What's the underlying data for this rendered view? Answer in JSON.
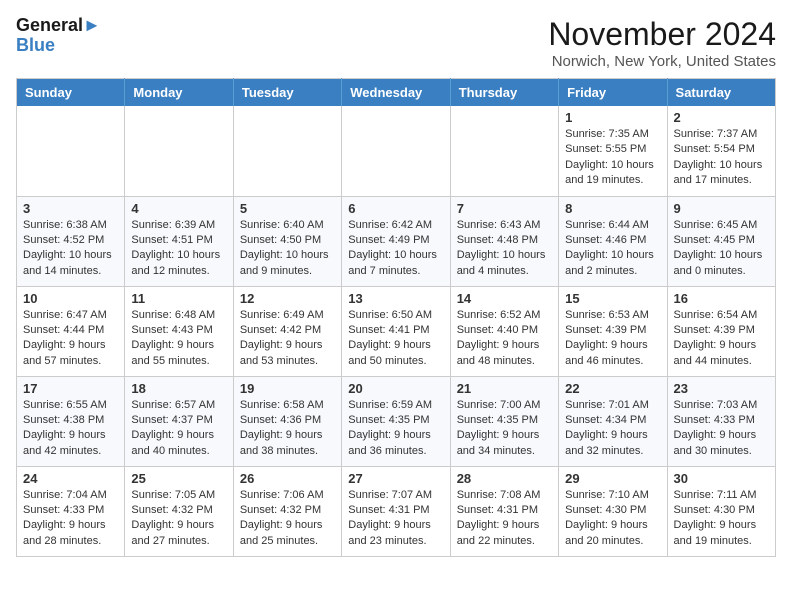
{
  "header": {
    "logo_line1": "General",
    "logo_line2": "Blue",
    "month_title": "November 2024",
    "location": "Norwich, New York, United States"
  },
  "weekdays": [
    "Sunday",
    "Monday",
    "Tuesday",
    "Wednesday",
    "Thursday",
    "Friday",
    "Saturday"
  ],
  "weeks": [
    [
      {
        "day": "",
        "text": ""
      },
      {
        "day": "",
        "text": ""
      },
      {
        "day": "",
        "text": ""
      },
      {
        "day": "",
        "text": ""
      },
      {
        "day": "",
        "text": ""
      },
      {
        "day": "1",
        "text": "Sunrise: 7:35 AM\nSunset: 5:55 PM\nDaylight: 10 hours and 19 minutes."
      },
      {
        "day": "2",
        "text": "Sunrise: 7:37 AM\nSunset: 5:54 PM\nDaylight: 10 hours and 17 minutes."
      }
    ],
    [
      {
        "day": "3",
        "text": "Sunrise: 6:38 AM\nSunset: 4:52 PM\nDaylight: 10 hours and 14 minutes."
      },
      {
        "day": "4",
        "text": "Sunrise: 6:39 AM\nSunset: 4:51 PM\nDaylight: 10 hours and 12 minutes."
      },
      {
        "day": "5",
        "text": "Sunrise: 6:40 AM\nSunset: 4:50 PM\nDaylight: 10 hours and 9 minutes."
      },
      {
        "day": "6",
        "text": "Sunrise: 6:42 AM\nSunset: 4:49 PM\nDaylight: 10 hours and 7 minutes."
      },
      {
        "day": "7",
        "text": "Sunrise: 6:43 AM\nSunset: 4:48 PM\nDaylight: 10 hours and 4 minutes."
      },
      {
        "day": "8",
        "text": "Sunrise: 6:44 AM\nSunset: 4:46 PM\nDaylight: 10 hours and 2 minutes."
      },
      {
        "day": "9",
        "text": "Sunrise: 6:45 AM\nSunset: 4:45 PM\nDaylight: 10 hours and 0 minutes."
      }
    ],
    [
      {
        "day": "10",
        "text": "Sunrise: 6:47 AM\nSunset: 4:44 PM\nDaylight: 9 hours and 57 minutes."
      },
      {
        "day": "11",
        "text": "Sunrise: 6:48 AM\nSunset: 4:43 PM\nDaylight: 9 hours and 55 minutes."
      },
      {
        "day": "12",
        "text": "Sunrise: 6:49 AM\nSunset: 4:42 PM\nDaylight: 9 hours and 53 minutes."
      },
      {
        "day": "13",
        "text": "Sunrise: 6:50 AM\nSunset: 4:41 PM\nDaylight: 9 hours and 50 minutes."
      },
      {
        "day": "14",
        "text": "Sunrise: 6:52 AM\nSunset: 4:40 PM\nDaylight: 9 hours and 48 minutes."
      },
      {
        "day": "15",
        "text": "Sunrise: 6:53 AM\nSunset: 4:39 PM\nDaylight: 9 hours and 46 minutes."
      },
      {
        "day": "16",
        "text": "Sunrise: 6:54 AM\nSunset: 4:39 PM\nDaylight: 9 hours and 44 minutes."
      }
    ],
    [
      {
        "day": "17",
        "text": "Sunrise: 6:55 AM\nSunset: 4:38 PM\nDaylight: 9 hours and 42 minutes."
      },
      {
        "day": "18",
        "text": "Sunrise: 6:57 AM\nSunset: 4:37 PM\nDaylight: 9 hours and 40 minutes."
      },
      {
        "day": "19",
        "text": "Sunrise: 6:58 AM\nSunset: 4:36 PM\nDaylight: 9 hours and 38 minutes."
      },
      {
        "day": "20",
        "text": "Sunrise: 6:59 AM\nSunset: 4:35 PM\nDaylight: 9 hours and 36 minutes."
      },
      {
        "day": "21",
        "text": "Sunrise: 7:00 AM\nSunset: 4:35 PM\nDaylight: 9 hours and 34 minutes."
      },
      {
        "day": "22",
        "text": "Sunrise: 7:01 AM\nSunset: 4:34 PM\nDaylight: 9 hours and 32 minutes."
      },
      {
        "day": "23",
        "text": "Sunrise: 7:03 AM\nSunset: 4:33 PM\nDaylight: 9 hours and 30 minutes."
      }
    ],
    [
      {
        "day": "24",
        "text": "Sunrise: 7:04 AM\nSunset: 4:33 PM\nDaylight: 9 hours and 28 minutes."
      },
      {
        "day": "25",
        "text": "Sunrise: 7:05 AM\nSunset: 4:32 PM\nDaylight: 9 hours and 27 minutes."
      },
      {
        "day": "26",
        "text": "Sunrise: 7:06 AM\nSunset: 4:32 PM\nDaylight: 9 hours and 25 minutes."
      },
      {
        "day": "27",
        "text": "Sunrise: 7:07 AM\nSunset: 4:31 PM\nDaylight: 9 hours and 23 minutes."
      },
      {
        "day": "28",
        "text": "Sunrise: 7:08 AM\nSunset: 4:31 PM\nDaylight: 9 hours and 22 minutes."
      },
      {
        "day": "29",
        "text": "Sunrise: 7:10 AM\nSunset: 4:30 PM\nDaylight: 9 hours and 20 minutes."
      },
      {
        "day": "30",
        "text": "Sunrise: 7:11 AM\nSunset: 4:30 PM\nDaylight: 9 hours and 19 minutes."
      }
    ]
  ]
}
